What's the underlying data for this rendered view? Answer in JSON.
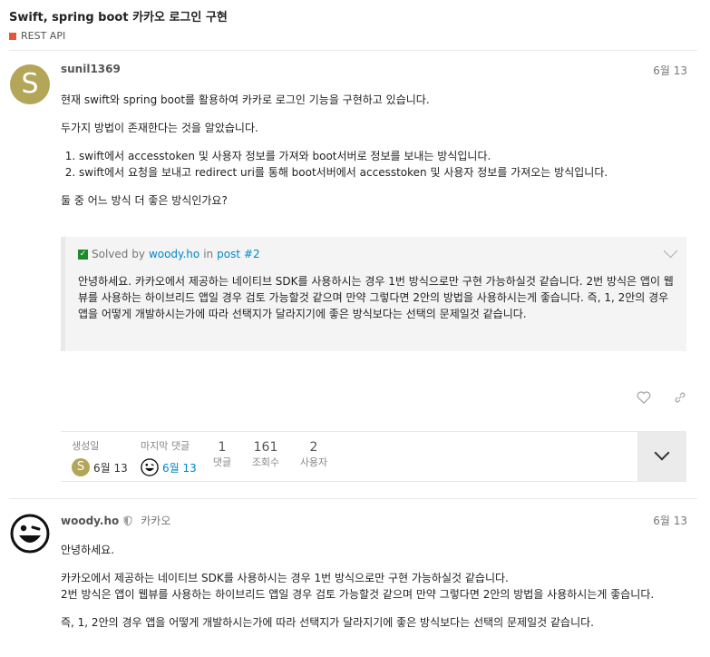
{
  "topic": {
    "title": "Swift, spring boot 카카오 로그인 구현",
    "category": "REST API",
    "category_color": "#e45735"
  },
  "post1": {
    "avatar_letter": "S",
    "avatar_color": "#b3a659",
    "username": "sunil1369",
    "date": "6월 13",
    "p1": "현재 swift와 spring boot를 활용하여 카카로 로그인 기능을 구현하고 있습니다.",
    "p2": "두가지 방법이 존재한다는 것을 알았습니다.",
    "list": [
      "swift에서 accesstoken 및 사용자 정보를 가져와 boot서버로 정보를 보내는 방식입니다.",
      "swift에서 요청을 보내고 redirect uri를 통해 boot서버에서 accesstoken 및 사용자 정보를 가져오는 방식입니다."
    ],
    "p3": "둘 중 어느 방식 더 좋은 방식인가요?",
    "solution": {
      "solved_by_text": "Solved by",
      "solver": "woody.ho",
      "in_text": "in",
      "post_ref": "post #2",
      "body": "안녕하세요. 카카오에서 제공하는 네이티브 SDK를 사용하시는 경우 1번 방식으로만 구현 가능하실것 같습니다. 2번 방식은 앱이 웹뷰를 사용하는 하이브리드 앱일 경우 검토 가능할것 같으며 만약 그렇다면 2안의 방법을 사용하시는게 좋습니다. 즉, 1, 2안의 경우 앱을 어떻게 개발하시는가에 따라 선택지가 달라지기에 좋은 방식보다는 선택의 문제일것 같습니다."
    },
    "stats": {
      "created_label": "생성일",
      "created_date": "6월 13",
      "last_reply_label": "마지막 댓글",
      "last_reply_date": "6월 13",
      "replies_num": "1",
      "replies_label": "댓글",
      "views_num": "161",
      "views_label": "조회수",
      "users_num": "2",
      "users_label": "사용자"
    }
  },
  "post2": {
    "username": "woody.ho",
    "org": "카카오",
    "date": "6월 13",
    "p1": "안녕하세요.",
    "p2a": "카카오에서 제공하는 네이티브 SDK를 사용하시는 경우 1번 방식으로만 구현 가능하실것 같습니다.",
    "p2b": "2번 방식은 앱이 웹뷰를 사용하는 하이브리드 앱일 경우 검토 가능할것 같으며 만약 그렇다면 2안의 방법을 사용하시는게 좋습니다.",
    "p3": "즉, 1, 2안의 경우 앱을 어떻게 개발하시는가에 따라 선택지가 달라지기에 좋은 방식보다는 선택의 문제일것 같습니다."
  }
}
